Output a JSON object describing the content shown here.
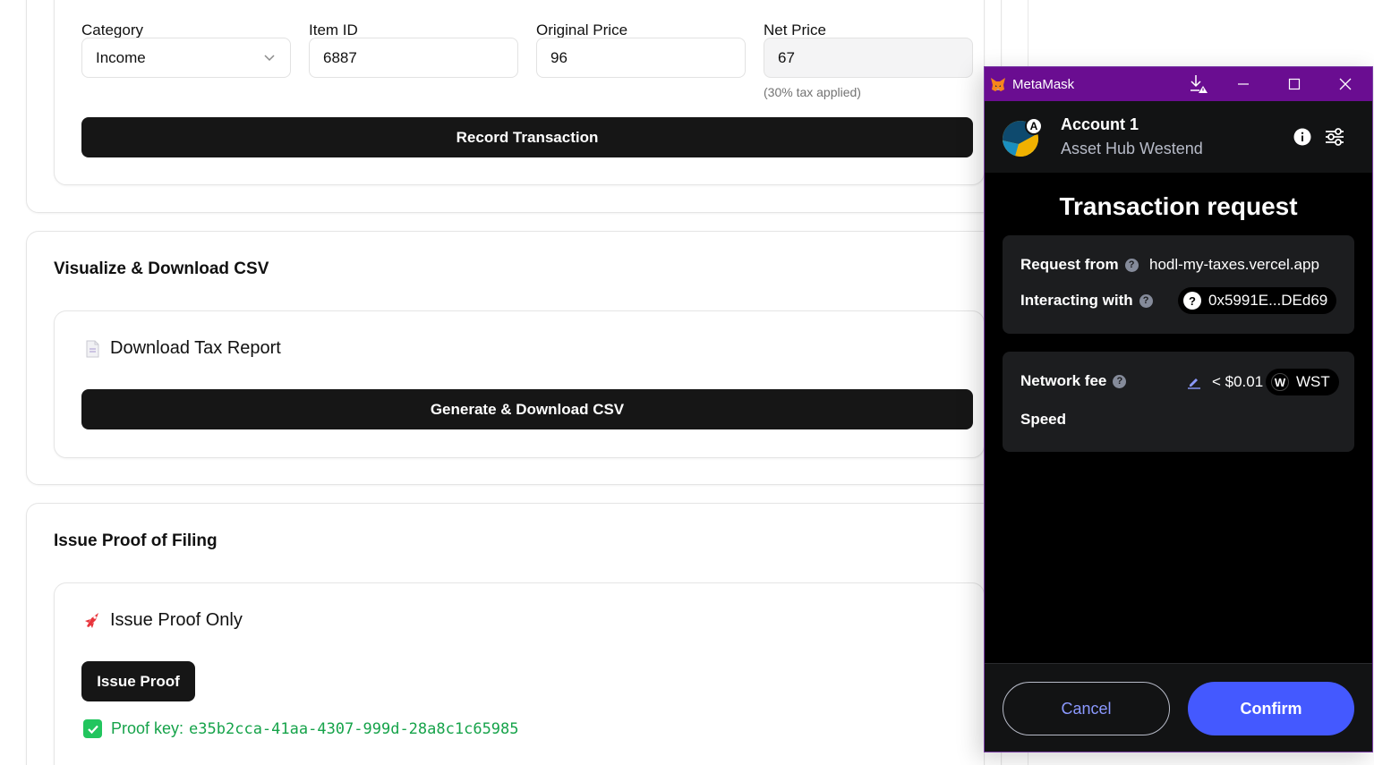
{
  "transaction_form": {
    "category_label": "Category",
    "category_value": "Income",
    "item_id_label": "Item ID",
    "item_id_value": "6887",
    "original_price_label": "Original Price",
    "original_price_value": "96",
    "net_price_label": "Net Price",
    "net_price_value": "67",
    "tax_hint": "(30% tax applied)",
    "record_button": "Record Transaction"
  },
  "csv_section": {
    "title": "Visualize & Download CSV",
    "card_title": "Download Tax Report",
    "card_icon": "document-icon",
    "button": "Generate & Download CSV"
  },
  "proof_section": {
    "title": "Issue Proof of Filing",
    "card_title": "Issue Proof Only",
    "card_icon": "rocket-icon",
    "button": "Issue Proof",
    "proof_label": "Proof key:",
    "proof_key": "e35b2cca-41aa-4307-999d-28a8c1c65985"
  },
  "metamask": {
    "window_title": "MetaMask",
    "account_name": "Account 1",
    "avatar_badge": "A",
    "network_name": "Asset Hub Westend",
    "heading": "Transaction request",
    "request_from_label": "Request from",
    "request_from_value": "hodl-my-taxes.vercel.app",
    "interacting_with_label": "Interacting with",
    "interacting_with_value": "0x5991E...DEd69",
    "interacting_icon": "?",
    "network_fee_label": "Network fee",
    "network_fee_value": "< $0.01",
    "fee_token_icon": "W",
    "fee_token": "WST",
    "speed_label": "Speed",
    "cancel_button": "Cancel",
    "confirm_button": "Confirm"
  },
  "colors": {
    "primary_button": "#161616",
    "metamask_titlebar": "#6a0d91",
    "metamask_confirm": "#4459ff",
    "proof_green": "#16a34a"
  }
}
